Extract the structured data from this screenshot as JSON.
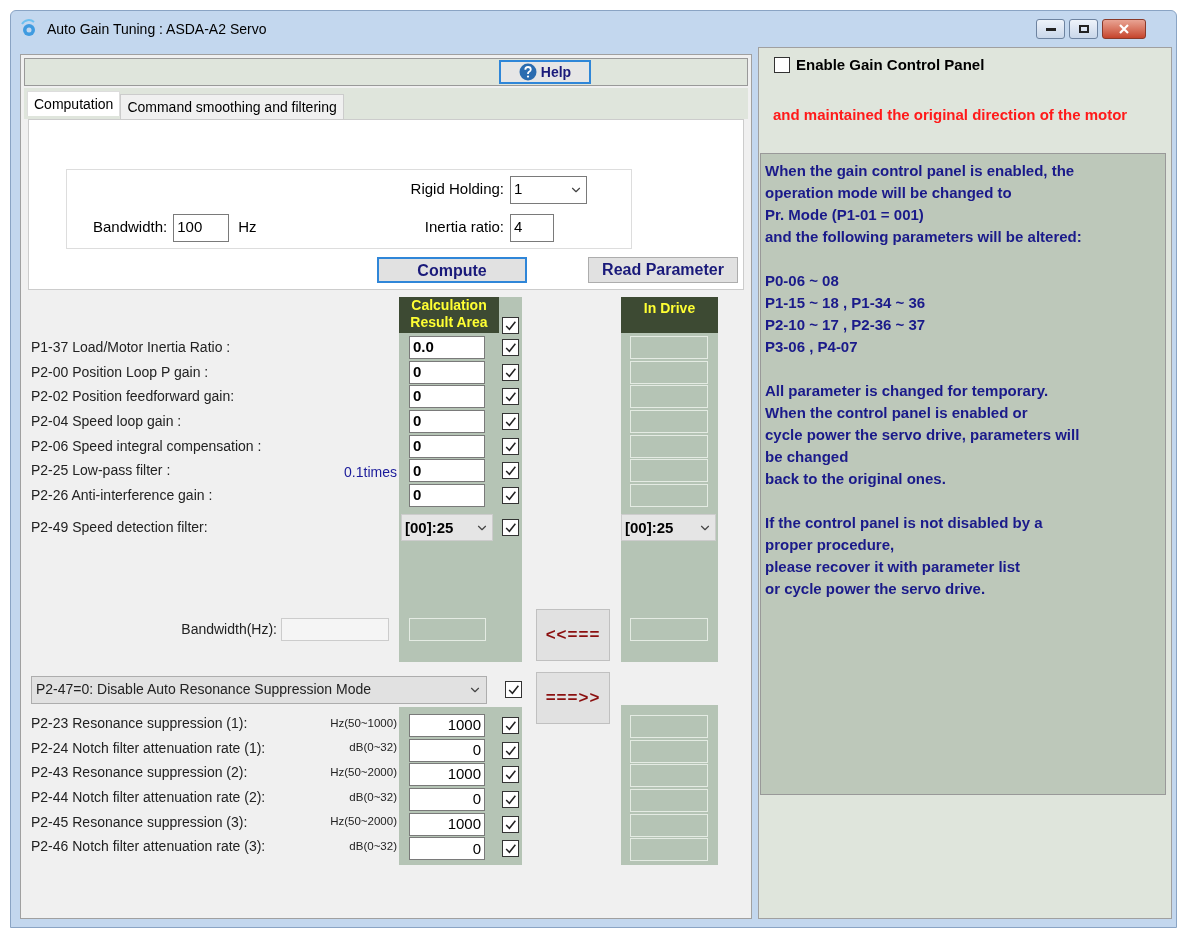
{
  "window": {
    "title": "Auto Gain Tuning : ASDA-A2 Servo"
  },
  "toolbar": {
    "help_button": "Help"
  },
  "tabs": [
    {
      "label": "Computation",
      "selected": true
    },
    {
      "label": "Command smoothing and filtering",
      "selected": false
    }
  ],
  "computation": {
    "rigid_holding": {
      "label": "Rigid Holding:",
      "value": "1"
    },
    "bandwidth": {
      "label": "Bandwidth:",
      "value": "100",
      "unit": "Hz"
    },
    "inertia_ratio": {
      "label": "Inertia ratio:",
      "value": "4"
    },
    "compute_button": "Compute",
    "read_parameter_button": "Read Parameter"
  },
  "results": {
    "calc_header": "Calculation Result Area",
    "calc_header_checked": true,
    "drive_header": "In Drive",
    "rows": [
      {
        "label": "P1-37 Load/Motor Inertia Ratio :",
        "value": "0.0",
        "checked": true
      },
      {
        "label": "P2-00 Position Loop P gain :",
        "value": "0",
        "checked": true
      },
      {
        "label": "P2-02 Position feedforward gain:",
        "value": "0",
        "checked": true
      },
      {
        "label": "P2-04 Speed loop gain :",
        "value": "0",
        "checked": true
      },
      {
        "label": "P2-06 Speed integral compensation :",
        "value": "0",
        "checked": true
      },
      {
        "label": "P2-25 Low-pass filter :",
        "unit": "0.1times",
        "value": "0",
        "checked": true
      },
      {
        "label": "P2-26 Anti-interference gain :",
        "value": "0",
        "checked": true
      }
    ],
    "speed_filter": {
      "label": "P2-49 Speed detection filter:",
      "calc_value": "[00]:25",
      "checked": true,
      "drive_value": "[00]:25"
    },
    "bandwidth_label": "Bandwidth(Hz):",
    "copy_left_button": "<<===",
    "copy_right_button": "===>>"
  },
  "resonance": {
    "mode": "P2-47=0: Disable Auto Resonance Suppression Mode",
    "mode_checked": true,
    "rows": [
      {
        "label": "P2-23 Resonance suppression (1):",
        "range": "Hz(50~1000)",
        "value": "1000",
        "checked": true
      },
      {
        "label": "P2-24 Notch filter attenuation rate (1):",
        "range": "dB(0~32)",
        "value": "0",
        "checked": true
      },
      {
        "label": "P2-43 Resonance suppression (2):",
        "range": "Hz(50~2000)",
        "value": "1000",
        "checked": true
      },
      {
        "label": "P2-44 Notch filter attenuation rate (2):",
        "range": "dB(0~32)",
        "value": "0",
        "checked": true
      },
      {
        "label": "P2-45 Resonance suppression (3):",
        "range": "Hz(50~2000)",
        "value": "1000",
        "checked": true
      },
      {
        "label": "P2-46 Notch filter attenuation rate (3):",
        "range": "dB(0~32)",
        "value": "0",
        "checked": true
      }
    ]
  },
  "side_panel": {
    "enable": {
      "label": "Enable Gain Control Panel",
      "checked": false
    },
    "warning": "and maintained the original direction of the motor",
    "info": [
      [
        "When the gain control panel is enabled, the",
        "operation mode will be changed to",
        "Pr. Mode (P1-01 = 001)",
        "and the following parameters will be altered:"
      ],
      [
        "P0-06 ~ 08",
        "P1-15 ~ 18 , P1-34 ~ 36",
        "P2-10 ~ 17 , P2-36 ~ 37",
        "P3-06 , P4-07"
      ],
      [
        "All parameter is changed for temporary.",
        "When the control panel is enabled or",
        "cycle power the servo drive, parameters will",
        "be changed",
        "back to the original ones."
      ],
      [
        "If the control panel is not disabled by a",
        "proper procedure,",
        "please recover it with parameter list",
        "or cycle power the servo drive."
      ]
    ]
  }
}
